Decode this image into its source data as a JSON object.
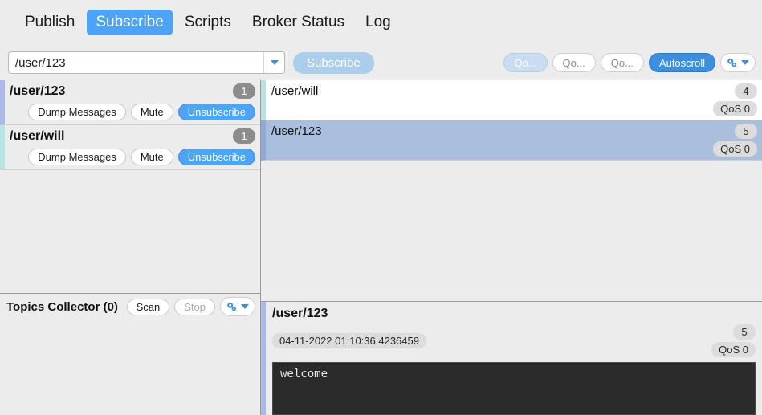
{
  "tabs": [
    {
      "label": "Publish",
      "active": false
    },
    {
      "label": "Subscribe",
      "active": true
    },
    {
      "label": "Scripts",
      "active": false
    },
    {
      "label": "Broker Status",
      "active": false
    },
    {
      "label": "Log",
      "active": false
    }
  ],
  "toolbar": {
    "topic_value": "/user/123",
    "topic_placeholder": "",
    "subscribe_label": "Subscribe",
    "filters": [
      {
        "label": "Qo...",
        "active": true
      },
      {
        "label": "Qo...",
        "active": false
      },
      {
        "label": "Qo...",
        "active": false
      }
    ],
    "autoscroll_label": "Autoscroll",
    "settings_icon": "gear-dropdown-icon"
  },
  "subscriptions": [
    {
      "topic": "/user/123",
      "count": "1",
      "stripe": "#aab8e8",
      "dump_label": "Dump Messages",
      "mute_label": "Mute",
      "unsubscribe_label": "Unsubscribe"
    },
    {
      "topic": "/user/will",
      "count": "1",
      "stripe": "#b7e4e0",
      "dump_label": "Dump Messages",
      "mute_label": "Mute",
      "unsubscribe_label": "Unsubscribe"
    }
  ],
  "collector": {
    "title": "Topics Collector (0)",
    "scan_label": "Scan",
    "stop_label": "Stop",
    "settings_icon": "gear-dropdown-icon"
  },
  "messages": [
    {
      "topic": "/user/will",
      "count": "4",
      "qos": "QoS 0",
      "selected": false,
      "stripe": "#b7e4e0"
    },
    {
      "topic": "/user/123",
      "count": "5",
      "qos": "QoS 0",
      "selected": true,
      "stripe": "#8fa8d4"
    }
  ],
  "detail": {
    "topic": "/user/123",
    "timestamp": "04-11-2022  01:10:36.4236459",
    "count": "5",
    "qos": "QoS 0",
    "payload": "welcome"
  },
  "colors": {
    "accent": "#4da3f7",
    "accent_dark": "#3b8fe0",
    "window_bg": "#ececec",
    "selected_row": "#aabede",
    "payload_bg": "#2b2b2b"
  }
}
